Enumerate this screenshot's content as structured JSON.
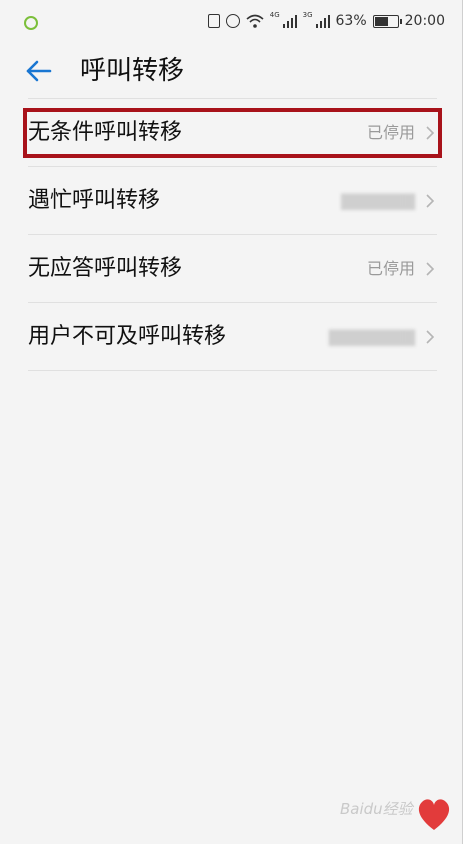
{
  "status_bar": {
    "network_left": "4G",
    "network_right": "3G",
    "battery_percent": "63%",
    "battery_level": 0.63,
    "time": "20:00"
  },
  "header": {
    "title": "呼叫转移"
  },
  "items": [
    {
      "label": "无条件呼叫转移",
      "status": "已停用"
    },
    {
      "label": "遇忙呼叫转移",
      "status": ""
    },
    {
      "label": "无应答呼叫转移",
      "status": "已停用"
    },
    {
      "label": "用户不可及呼叫转移",
      "status": ""
    }
  ],
  "colors": {
    "accent": "#1976d2",
    "highlight": "#a8121a",
    "background": "#f4f4f4",
    "divider": "#e0e0e0",
    "secondary_text": "#9a9a9a"
  },
  "watermark": {
    "logo_text": "Baidu经验",
    "signature": "Love"
  }
}
